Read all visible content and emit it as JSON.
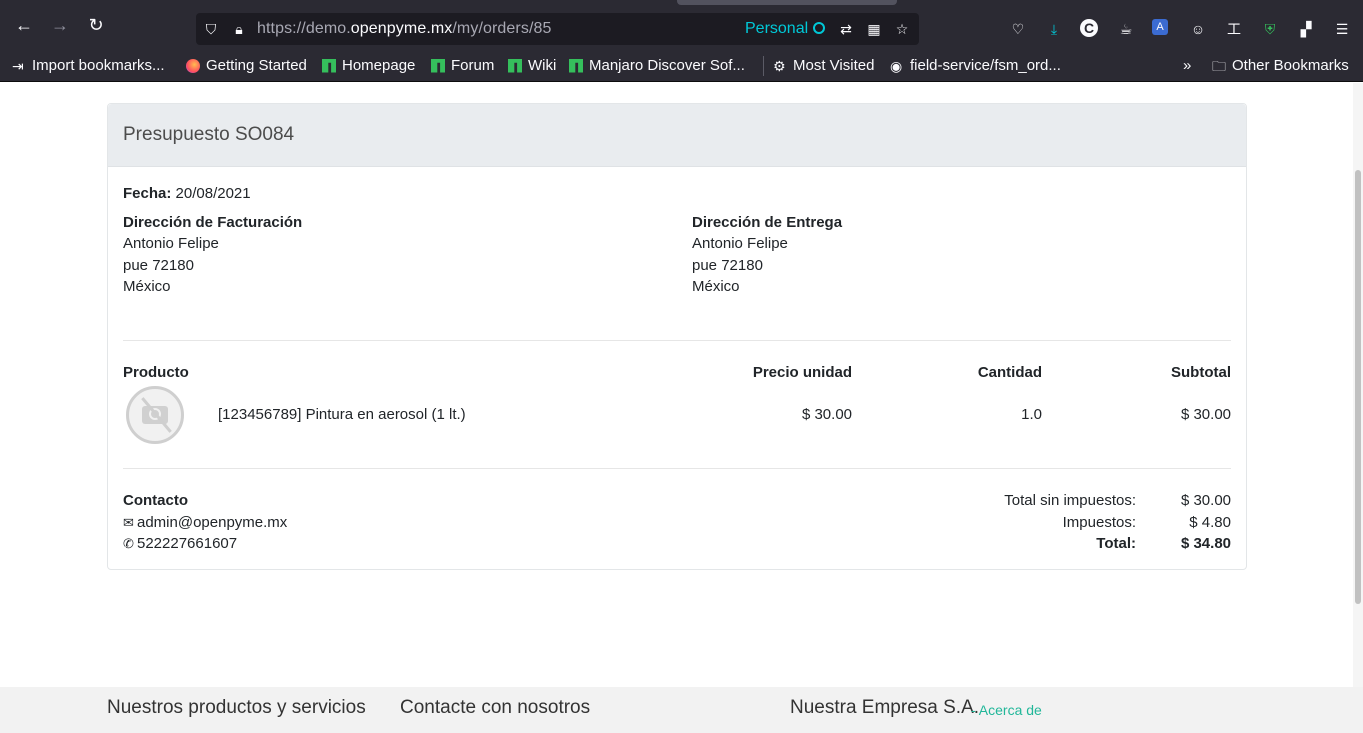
{
  "browser": {
    "url_prefix": "https://demo.",
    "url_domain": "openpyme.mx",
    "url_path": "/my/orders/85",
    "container": "Personal",
    "bookmarks": [
      {
        "label": "Import bookmarks...",
        "icon": "import-icon"
      },
      {
        "label": "Getting Started",
        "icon": "firefox-icon"
      },
      {
        "label": "Homepage",
        "icon": "manjaro-icon"
      },
      {
        "label": "Forum",
        "icon": "manjaro-icon"
      },
      {
        "label": "Wiki",
        "icon": "manjaro-icon"
      },
      {
        "label": "Manjaro Discover Sof...",
        "icon": "manjaro-icon"
      },
      {
        "label": "Most Visited",
        "icon": "gear-icon"
      },
      {
        "label": "field-service/fsm_ord...",
        "icon": "github-icon"
      }
    ],
    "other_bookmarks": "Other Bookmarks"
  },
  "order": {
    "title": "Presupuesto SO084",
    "date_label": "Fecha:",
    "date_value": "20/08/2021",
    "billing": {
      "heading": "Dirección de Facturación",
      "name": "Antonio Felipe",
      "line1": "pue 72180",
      "country": "México"
    },
    "shipping": {
      "heading": "Dirección de Entrega",
      "name": "Antonio Felipe",
      "line1": "pue 72180",
      "country": "México"
    },
    "table": {
      "col_product": "Producto",
      "col_unit_price": "Precio unidad",
      "col_qty": "Cantidad",
      "col_subtotal": "Subtotal",
      "rows": [
        {
          "product": "[123456789] Pintura en aerosol (1 lt.)",
          "unit_price": "$ 30.00",
          "qty": "1.0",
          "subtotal": "$ 30.00"
        }
      ]
    },
    "contact": {
      "heading": "Contacto",
      "email": "admin@openpyme.mx",
      "phone": "522227661607"
    },
    "totals": {
      "untaxed_label": "Total sin impuestos:",
      "untaxed_value": "$ 30.00",
      "taxes_label": "Impuestos:",
      "taxes_value": "$ 4.80",
      "total_label": "Total:",
      "total_value": "$ 34.80"
    }
  },
  "footer": {
    "col1": "Nuestros productos y servicios",
    "col2": "Contacte con nosotros",
    "col3": "Nuestra Empresa S.A.",
    "about_link": "- Acerca de"
  },
  "colors": {
    "chrome_bg": "#2b2a33",
    "urlbar_bg": "#1c1b22",
    "container_accent": "#00c8d7",
    "card_header_bg": "#e9ecef",
    "link_accent": "#21b799"
  }
}
